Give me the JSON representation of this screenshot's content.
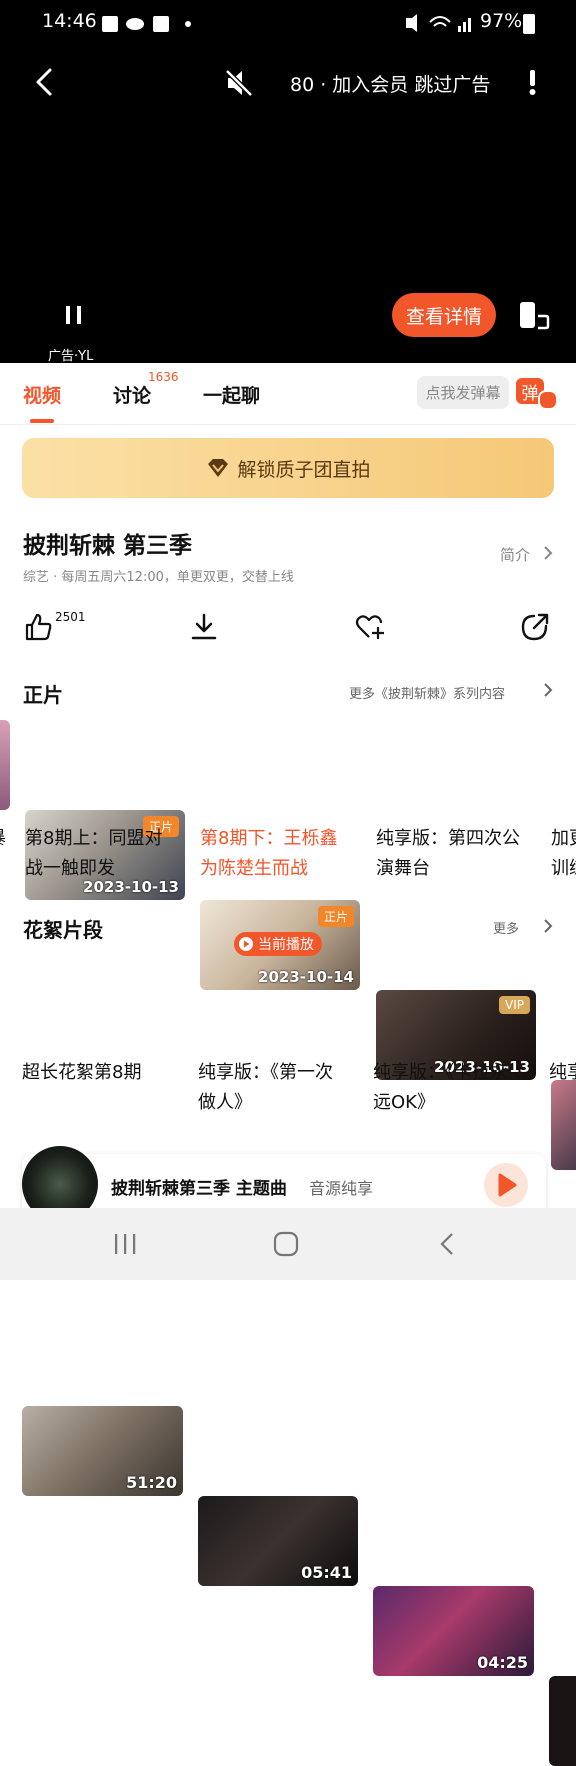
{
  "status": {
    "time": "14:46",
    "battery": "97%"
  },
  "player": {
    "ad_text": "80 · 加入会员 跳过广告",
    "details_button": "查看详情",
    "ad_label": "广告·YL"
  },
  "tabs": [
    {
      "label": "视频"
    },
    {
      "label": "讨论",
      "badge": "1636"
    },
    {
      "label": "一起聊"
    }
  ],
  "danmu": {
    "placeholder": "点我发弹幕",
    "icon": "弹"
  },
  "banner": {
    "label": "解锁质子团直拍"
  },
  "show": {
    "title": "披荆斩棘 第三季",
    "intro": "简介",
    "meta": "综艺 · 每周五周六12:00，单更双更，交替上线",
    "likes": "2501"
  },
  "episodes": {
    "title": "正片",
    "more": "更多《披荆斩棘》系列内容",
    "items": [
      {
        "tag": "正片",
        "date": "2023-10-13",
        "caption1": "第8期上：同盟对",
        "caption2": "战一触即发"
      },
      {
        "tag": "正片",
        "date": "2023-10-14",
        "now": "当前播放",
        "caption1": "第8期下：王栎鑫",
        "caption2": "为陈楚生而战"
      },
      {
        "tag": "VIP",
        "date": "2023-10-13",
        "caption1": "纯享版：第四次公",
        "caption2": "演舞台"
      },
      {
        "caption1": "加更",
        "caption2": "训练"
      }
    ],
    "partial_left": "暴"
  },
  "clips": {
    "title": "花絮片段",
    "more": "更多",
    "items": [
      {
        "dur": "51:20",
        "caption1": "超长花絮第8期",
        "caption2": ""
      },
      {
        "dur": "05:41",
        "caption1": "纯享版：《第一次",
        "caption2": "做人》"
      },
      {
        "dur": "04:25",
        "caption1": "纯享版：《卡拉永",
        "caption2": "远OK》"
      },
      {
        "caption1": "纯享",
        "caption2": ""
      }
    ]
  },
  "music": {
    "title": "披荆斩棘第三季 主题曲",
    "sub": "音源纯享"
  },
  "colors": {
    "accent": "#f2562b",
    "banner": "#f5c877"
  }
}
